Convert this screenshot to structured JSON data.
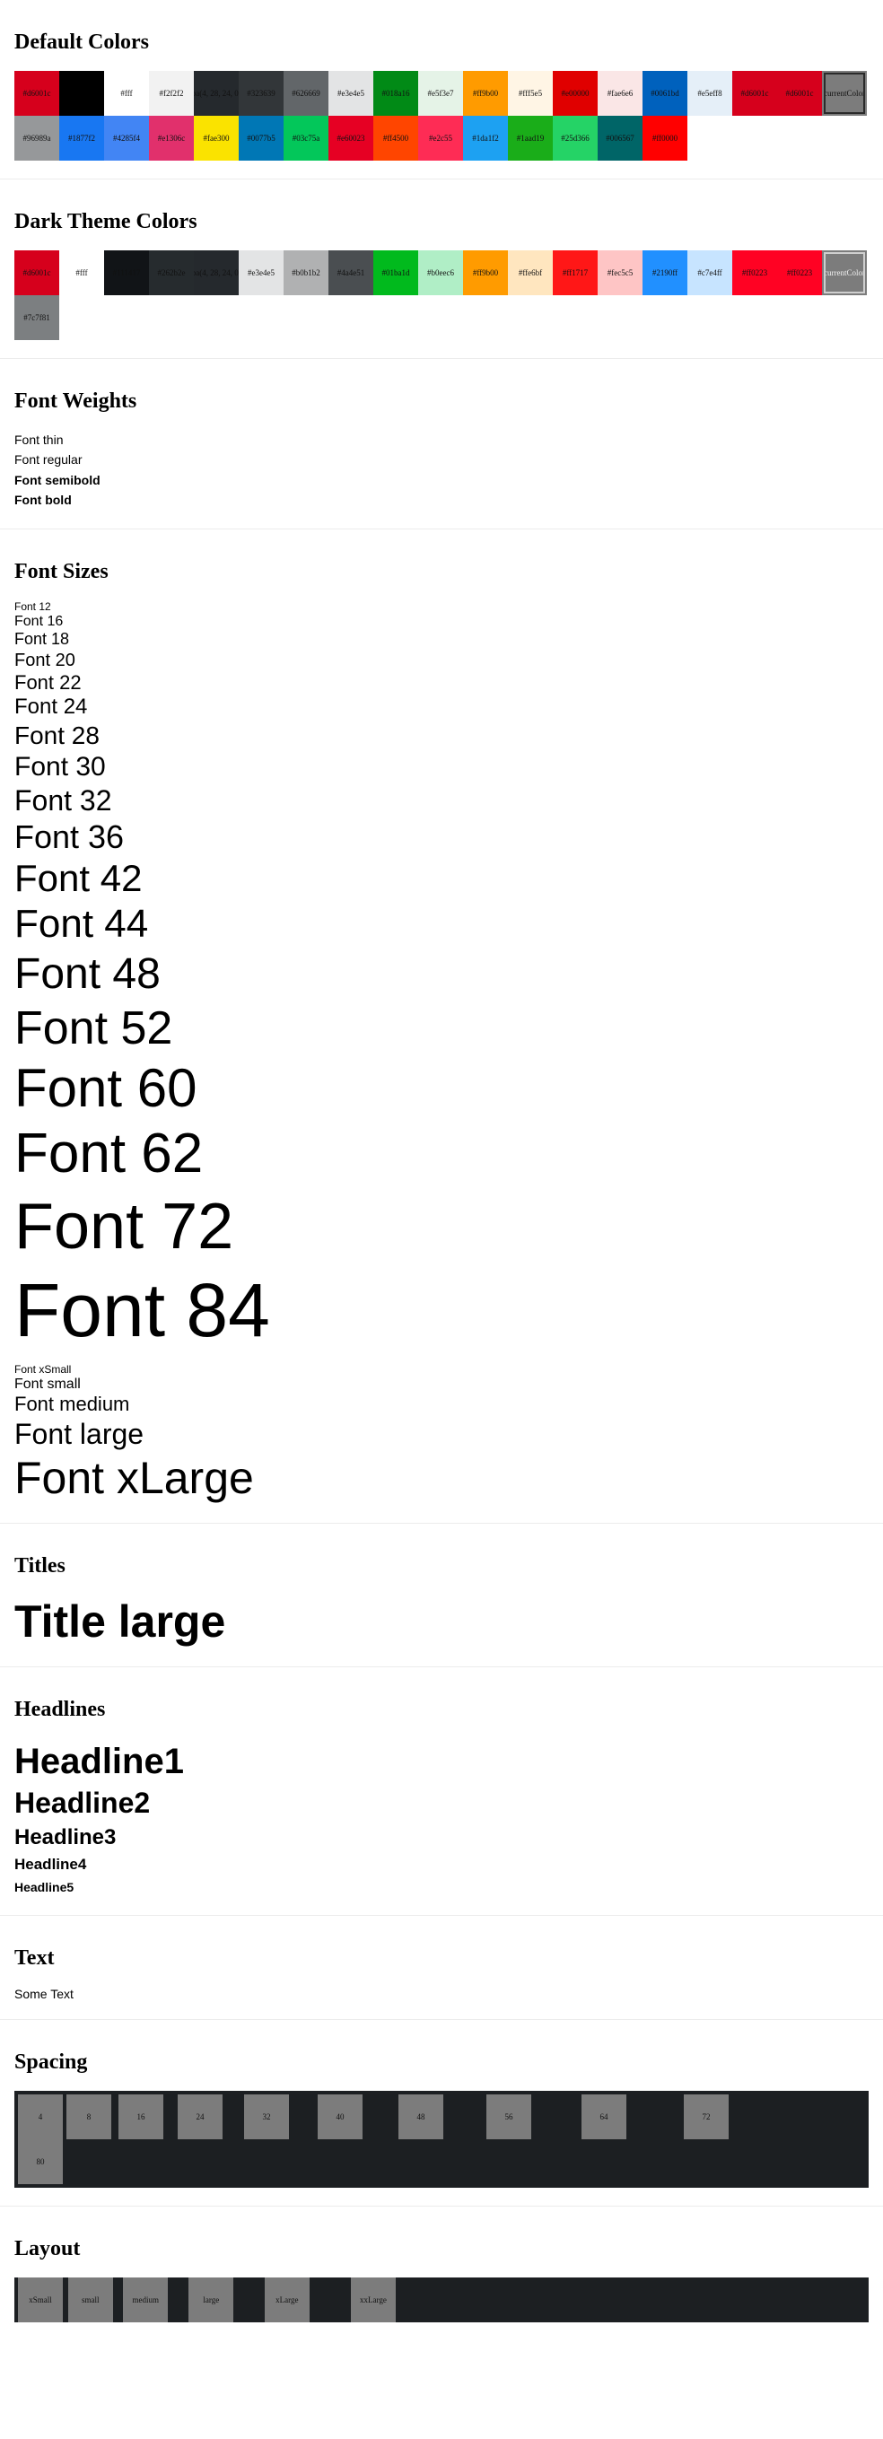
{
  "sections": {
    "default_colors": "Default Colors",
    "dark_colors": "Dark Theme Colors",
    "font_weights": "Font Weights",
    "font_sizes": "Font Sizes",
    "titles": "Titles",
    "headlines": "Headlines",
    "text": "Text",
    "spacing": "Spacing",
    "layout": "Layout"
  },
  "default_colors": [
    {
      "label": "#d6001c",
      "bg": "#d6001c",
      "fg": "#111111"
    },
    {
      "label": "#000",
      "bg": "#000000",
      "fg": "#000000"
    },
    {
      "label": "#fff",
      "bg": "#ffffff",
      "fg": "#111111"
    },
    {
      "label": "#f2f2f2",
      "bg": "#f2f2f2",
      "fg": "#111111"
    },
    {
      "label": "rgba(4, 28, 24, 0.9)",
      "bg": "#25292d",
      "fg": "#111111"
    },
    {
      "label": "#323639",
      "bg": "#323639",
      "fg": "#111111"
    },
    {
      "label": "#626669",
      "bg": "#626669",
      "fg": "#111111"
    },
    {
      "label": "#e3e4e5",
      "bg": "#e3e4e5",
      "fg": "#111111"
    },
    {
      "label": "#018a16",
      "bg": "#018a16",
      "fg": "#111111"
    },
    {
      "label": "#e5f3e7",
      "bg": "#e5f3e7",
      "fg": "#111111"
    },
    {
      "label": "#ff9b00",
      "bg": "#ff9b00",
      "fg": "#111111"
    },
    {
      "label": "#fff5e5",
      "bg": "#fff5e5",
      "fg": "#111111"
    },
    {
      "label": "#e00000",
      "bg": "#e00000",
      "fg": "#111111"
    },
    {
      "label": "#fae6e6",
      "bg": "#fae6e6",
      "fg": "#111111"
    },
    {
      "label": "#0061bd",
      "bg": "#0061bd",
      "fg": "#111111"
    },
    {
      "label": "#e5eff8",
      "bg": "#e5eff8",
      "fg": "#111111"
    },
    {
      "label": "#d6001c",
      "bg": "#d6001c",
      "fg": "#111111"
    },
    {
      "label": "#d6001c",
      "bg": "#d6001c",
      "fg": "#111111"
    },
    {
      "label": "currentColor",
      "bg": "#7c7c7c",
      "fg": "#111111",
      "outlined": true
    },
    {
      "label": "#96989a",
      "bg": "#96989a",
      "fg": "#111111"
    },
    {
      "label": "#1877f2",
      "bg": "#1877f2",
      "fg": "#111111"
    },
    {
      "label": "#4285f4",
      "bg": "#4285f4",
      "fg": "#111111"
    },
    {
      "label": "#e1306c",
      "bg": "#e1306c",
      "fg": "#111111"
    },
    {
      "label": "#fae300",
      "bg": "#fae300",
      "fg": "#111111"
    },
    {
      "label": "#0077b5",
      "bg": "#0077b5",
      "fg": "#111111"
    },
    {
      "label": "#03c75a",
      "bg": "#03c75a",
      "fg": "#111111"
    },
    {
      "label": "#e60023",
      "bg": "#e60023",
      "fg": "#111111"
    },
    {
      "label": "#ff4500",
      "bg": "#ff4500",
      "fg": "#111111"
    },
    {
      "label": "#e2c55",
      "bg": "#fe2c55",
      "fg": "#111111"
    },
    {
      "label": "#1da1f2",
      "bg": "#1da1f2",
      "fg": "#111111"
    },
    {
      "label": "#1aad19",
      "bg": "#1aad19",
      "fg": "#111111"
    },
    {
      "label": "#25d366",
      "bg": "#25d366",
      "fg": "#111111"
    },
    {
      "label": "#006567",
      "bg": "#006567",
      "fg": "#111111"
    },
    {
      "label": "#ff0000",
      "bg": "#ff0000",
      "fg": "#111111"
    }
  ],
  "dark_colors": [
    {
      "label": "#d6001c",
      "bg": "#d6001c",
      "fg": "#111111"
    },
    {
      "label": "#fff",
      "bg": "#ffffff",
      "fg": "#111111"
    },
    {
      "label": "#111417",
      "bg": "#111417",
      "fg": "#111111"
    },
    {
      "label": "#262b2e",
      "bg": "#262b2e",
      "fg": "#111111"
    },
    {
      "label": "rgba(4, 28, 24, 0.9)",
      "bg": "#25292d",
      "fg": "#111111"
    },
    {
      "label": "#e3e4e5",
      "bg": "#e3e4e5",
      "fg": "#111111"
    },
    {
      "label": "#b0b1b2",
      "bg": "#b0b1b2",
      "fg": "#111111"
    },
    {
      "label": "#4a4e51",
      "bg": "#4a4e51",
      "fg": "#111111"
    },
    {
      "label": "#01ba1d",
      "bg": "#01ba1d",
      "fg": "#111111"
    },
    {
      "label": "#b0eec6",
      "bg": "#b0eec6",
      "fg": "#111111"
    },
    {
      "label": "#ff9b00",
      "bg": "#ff9b00",
      "fg": "#111111"
    },
    {
      "label": "#ffe6bf",
      "bg": "#ffe6bf",
      "fg": "#111111"
    },
    {
      "label": "#ff1717",
      "bg": "#ff1717",
      "fg": "#111111"
    },
    {
      "label": "#fec5c5",
      "bg": "#fec5c5",
      "fg": "#111111"
    },
    {
      "label": "#2190ff",
      "bg": "#2190ff",
      "fg": "#111111"
    },
    {
      "label": "#c7e4ff",
      "bg": "#c7e4ff",
      "fg": "#111111"
    },
    {
      "label": "#ff0223",
      "bg": "#ff0223",
      "fg": "#111111"
    },
    {
      "label": "#ff0223",
      "bg": "#ff0223",
      "fg": "#111111"
    },
    {
      "label": "currentColor",
      "bg": "#7c7c7c",
      "fg": "#f0f0f0",
      "outlined_light": true
    },
    {
      "label": "#7c7f81",
      "bg": "#7c7f81",
      "fg": "#111111"
    }
  ],
  "font_weights": [
    {
      "text": "Font thin",
      "weight": "300"
    },
    {
      "text": "Font regular",
      "weight": "400"
    },
    {
      "text": "Font semibold",
      "weight": "600"
    },
    {
      "text": "Font bold",
      "weight": "700"
    }
  ],
  "font_sizes": [
    {
      "text": "Font 12",
      "size": 12
    },
    {
      "text": "Font 16",
      "size": 16
    },
    {
      "text": "Font 18",
      "size": 18
    },
    {
      "text": "Font 20",
      "size": 20
    },
    {
      "text": "Font 22",
      "size": 22
    },
    {
      "text": "Font 24",
      "size": 24
    },
    {
      "text": "Font 28",
      "size": 28
    },
    {
      "text": "Font 30",
      "size": 30
    },
    {
      "text": "Font 32",
      "size": 32
    },
    {
      "text": "Font 36",
      "size": 36
    },
    {
      "text": "Font 42",
      "size": 42
    },
    {
      "text": "Font 44",
      "size": 44
    },
    {
      "text": "Font 48",
      "size": 48
    },
    {
      "text": "Font 52",
      "size": 52
    },
    {
      "text": "Font 60",
      "size": 60
    },
    {
      "text": "Font 62",
      "size": 62
    },
    {
      "text": "Font 72",
      "size": 72
    },
    {
      "text": "Font 84",
      "size": 84
    },
    {
      "text": "Font xSmall",
      "size": 12
    },
    {
      "text": "Font small",
      "size": 16
    },
    {
      "text": "Font medium",
      "size": 22
    },
    {
      "text": "Font large",
      "size": 32
    },
    {
      "text": "Font xLarge",
      "size": 50
    }
  ],
  "titles": {
    "large": "Title large"
  },
  "headlines": {
    "h1": "Headline1",
    "h2": "Headline2",
    "h3": "Headline3",
    "h4": "Headline4",
    "h5": "Headline5"
  },
  "text": {
    "body": "Some Text"
  },
  "spacing": [
    {
      "label": "4",
      "value": 4
    },
    {
      "label": "8",
      "value": 8
    },
    {
      "label": "16",
      "value": 16
    },
    {
      "label": "24",
      "value": 24
    },
    {
      "label": "32",
      "value": 32
    },
    {
      "label": "40",
      "value": 40
    },
    {
      "label": "48",
      "value": 48
    },
    {
      "label": "56",
      "value": 56
    },
    {
      "label": "64",
      "value": 64
    },
    {
      "label": "72",
      "value": 72
    },
    {
      "label": "80",
      "value": 80
    }
  ],
  "layout": [
    {
      "label": "xSmall",
      "value": 8
    },
    {
      "label": "small",
      "value": 16
    },
    {
      "label": "medium",
      "value": 32
    },
    {
      "label": "large",
      "value": 48
    },
    {
      "label": "xLarge",
      "value": 64
    },
    {
      "label": "xxLarge",
      "value": 80
    }
  ]
}
